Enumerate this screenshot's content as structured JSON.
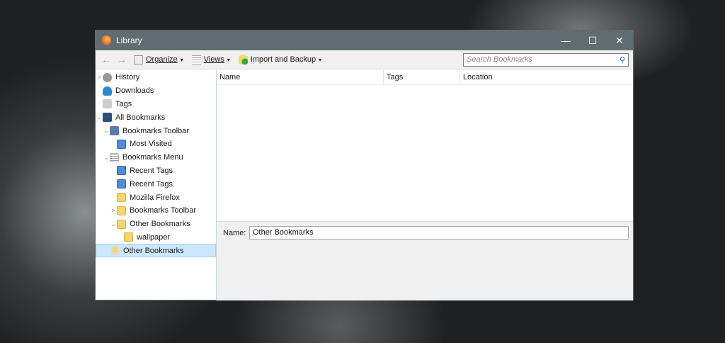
{
  "window": {
    "title": "Library",
    "min": "—",
    "max": "☐",
    "close": "✕"
  },
  "toolbar": {
    "back": "←",
    "forward": "→",
    "organize": "Organize",
    "views": "Views",
    "import_backup": "Import and Backup",
    "caret": "▾",
    "search_placeholder": "Search Bookmarks"
  },
  "sidebar": {
    "items": [
      {
        "label": "History",
        "twisty": ">"
      },
      {
        "label": "Downloads",
        "twisty": ""
      },
      {
        "label": "Tags",
        "twisty": ""
      },
      {
        "label": "All Bookmarks",
        "twisty": "v"
      },
      {
        "label": "Bookmarks Toolbar",
        "twisty": "v"
      },
      {
        "label": "Most Visited",
        "twisty": ""
      },
      {
        "label": "Bookmarks Menu",
        "twisty": "v"
      },
      {
        "label": "Recent Tags",
        "twisty": ""
      },
      {
        "label": "Recent Tags",
        "twisty": ""
      },
      {
        "label": "Mozilla Firefox",
        "twisty": ""
      },
      {
        "label": "Bookmarks Toolbar",
        "twisty": ">"
      },
      {
        "label": "Other Bookmarks",
        "twisty": "v"
      },
      {
        "label": "wallpaper",
        "twisty": ""
      },
      {
        "label": "Other Bookmarks",
        "twisty": ""
      }
    ]
  },
  "columns": [
    "Name",
    "Tags",
    "Location"
  ],
  "details": {
    "name_label": "Name:",
    "name_value": "Other Bookmarks"
  }
}
